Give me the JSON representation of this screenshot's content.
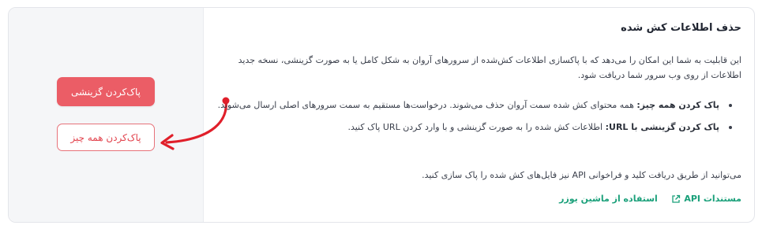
{
  "section": {
    "title": "حذف اطلاعات کش شده",
    "description": "این قابلیت به شما این امکان را می‌دهد که با پاکسازی اطلاعات کش‌شده از سرورهای آروان به شکل کامل یا به صورت گزینشی، نسخه جدید اطلاعات از روی وب سرور شما دریافت شود.",
    "bullets": [
      {
        "term": "پاک کردن همه چیز:",
        "text": " همه محتوای کش شده سمت آروان حذف می‌شوند. درخواست‌ها مستقیم به سمت سرورهای اصلی ارسال می‌شوند."
      },
      {
        "term": "پاک کردن گزینشی با URL:",
        "text": " اطلاعات کش شده را به صورت گزینشی و با وارد کردن URL پاک کنید."
      }
    ],
    "api_note": "می‌توانید از طریق دریافت کلید و فراخوانی API نیز فایل‌های کش شده را پاک سازی کنید.",
    "links": {
      "api_docs": "مستندات API",
      "machine_user": "استفاده از ماشین یوزر"
    }
  },
  "actions": {
    "purge_selective": "پاک‌کردن گزینشی",
    "purge_all": "پاک‌کردن همه چیز"
  },
  "icons": {
    "external_link": "external-link-icon",
    "arrow": "curved-arrow-icon"
  },
  "colors": {
    "danger": "#eb5d66",
    "link": "#1aa07a",
    "panel_bg": "#f5f6f8"
  }
}
